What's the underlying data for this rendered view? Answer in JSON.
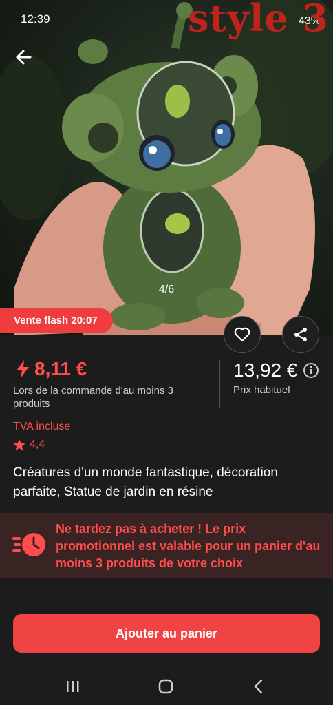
{
  "status_bar": {
    "time": "12:39",
    "battery": "43%"
  },
  "watermark": "style 3",
  "gallery": {
    "counter": "4/6"
  },
  "flash_sale": {
    "label": "Vente flash 20:07"
  },
  "price": {
    "promo": "8,11 €",
    "promo_note": "Lors de la commande d'au moins 3 produits",
    "regular": "13,92 €",
    "regular_label": "Prix habituel"
  },
  "vat": "TVA incluse",
  "rating": "4,4",
  "product_title": "Créatures d'un monde fantastique, décoration parfaite, Statue de jardin en résine",
  "urgency_banner": "Ne tardez pas à acheter ! Le prix promotionnel est valable pour un panier d'au moins 3 produits de votre choix",
  "cart_button": "Ajouter au panier",
  "colors": {
    "accent": "#f04343",
    "background": "#1c1c1c",
    "banner": "#3a2323"
  },
  "icons": [
    "back-arrow-icon",
    "heart-icon",
    "share-icon",
    "lightning-icon",
    "info-icon",
    "star-icon",
    "timer-icon",
    "recents-icon",
    "home-icon",
    "nav-back-icon"
  ]
}
